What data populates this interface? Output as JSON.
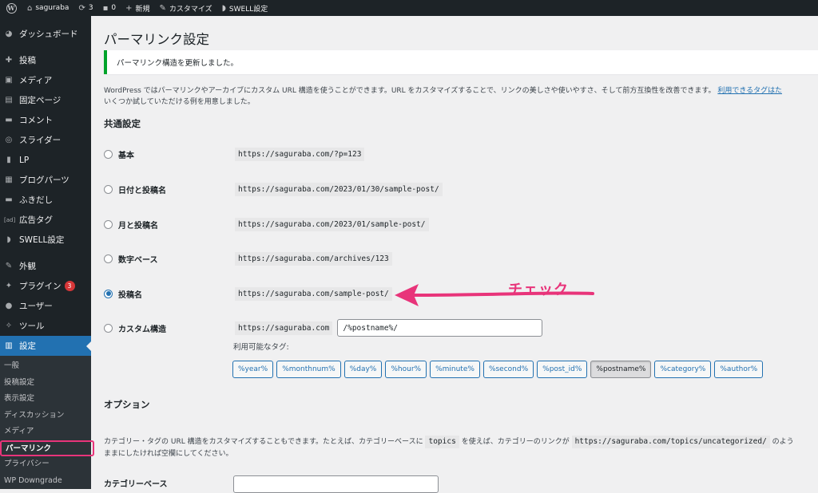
{
  "adminbar": {
    "site_name": "saguraba",
    "updates": "3",
    "comments": "0",
    "new": "新規",
    "customize": "カスタマイズ",
    "swell": "SWELL設定"
  },
  "sidebar": {
    "items": [
      {
        "label": "ダッシュボード",
        "icon": "dashboard-icon"
      },
      {
        "label": "投稿",
        "icon": "pin-icon"
      },
      {
        "label": "メディア",
        "icon": "media-icon"
      },
      {
        "label": "固定ページ",
        "icon": "page-icon"
      },
      {
        "label": "コメント",
        "icon": "comment-icon"
      },
      {
        "label": "スライダー",
        "icon": "slider-icon"
      },
      {
        "label": "LP",
        "icon": "lp-icon"
      },
      {
        "label": "ブログパーツ",
        "icon": "blog-parts-icon"
      },
      {
        "label": "ふきだし",
        "icon": "balloon-icon"
      },
      {
        "label": "広告タグ",
        "icon": "ad-icon"
      },
      {
        "label": "SWELL設定",
        "icon": "swell-icon"
      },
      {
        "label": "外観",
        "icon": "brush-icon"
      },
      {
        "label": "プラグイン",
        "icon": "plugin-icon",
        "badge": "3"
      },
      {
        "label": "ユーザー",
        "icon": "user-icon"
      },
      {
        "label": "ツール",
        "icon": "wrench-icon"
      },
      {
        "label": "設定",
        "icon": "settings-icon"
      }
    ],
    "submenu": [
      "一般",
      "投稿設定",
      "表示設定",
      "ディスカッション",
      "メディア",
      "パーマリンク",
      "プライバシー",
      "WP Downgrade"
    ]
  },
  "main": {
    "title": "パーマリンク設定",
    "notice": "パーマリンク構造を更新しました。",
    "intro_line1": "WordPress ではパーマリンクやアーカイブにカスタム URL 構造を使うことができます。URL をカスタマイズすることで、リンクの美しさや使いやすさ、そして前方互換性を改善できます。",
    "intro_link": "利用できるタグはた",
    "intro_line2": "いくつか試していただける例を用意しました。",
    "common_heading": "共通設定",
    "options": [
      {
        "label": "基本",
        "url": "https://saguraba.com/?p=123",
        "checked": false
      },
      {
        "label": "日付と投稿名",
        "url": "https://saguraba.com/2023/01/30/sample-post/",
        "checked": false
      },
      {
        "label": "月と投稿名",
        "url": "https://saguraba.com/2023/01/sample-post/",
        "checked": false
      },
      {
        "label": "数字ベース",
        "url": "https://saguraba.com/archives/123",
        "checked": false
      },
      {
        "label": "投稿名",
        "url": "https://saguraba.com/sample-post/",
        "checked": true
      }
    ],
    "custom_label": "カスタム構造",
    "custom_base": "https://saguraba.com",
    "custom_value": "/%postname%/",
    "available_tags_label": "利用可能なタグ:",
    "tags": [
      "%year%",
      "%monthnum%",
      "%day%",
      "%hour%",
      "%minute%",
      "%second%",
      "%post_id%",
      "%postname%",
      "%category%",
      "%author%"
    ],
    "active_tag": "%postname%",
    "option_heading": "オプション",
    "option_desc1a": "カテゴリー・タグの URL 構造をカスタマイズすることもできます。たとえば、カテゴリーベースに",
    "option_desc_code1": "topics",
    "option_desc1b": "を使えば、カテゴリーのリンクが",
    "option_desc_code2": "https://saguraba.com/topics/uncategorized/",
    "option_desc1c": "のよう",
    "option_desc2": "ままにしたければ空欄にしてください。",
    "category_base_label": "カテゴリーベース",
    "category_base_value": ""
  },
  "annotation": {
    "text": "チェック",
    "color": "#e8347a"
  }
}
